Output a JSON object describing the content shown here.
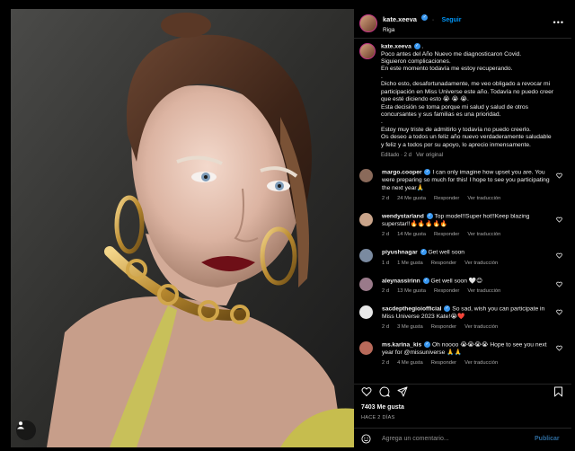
{
  "post": {
    "username": "kate.xeeva",
    "follow_label": "Seguir",
    "location": "Riga",
    "more_label": "•••"
  },
  "caption": {
    "username": "kate.xeeva",
    "lines": [
      "Poco antes del Año Nuevo me diagnosticaron Covid.",
      "Siguieron complicaciones.",
      "En este momento todavía me estoy recuperando.",
      ".",
      "Dicho esto, desafortunadamente, me veo obligado a revocar mi",
      "participación en Miss Universe este año. Todavía no puedo creer",
      "que esté diciendo esto 😭 😭 😭.",
      "Esta decisión se toma porque mi salud y salud de otros",
      "concursantes y sus familias es una prioridad.",
      ".",
      "Estoy muy triste de admitirlo y todavía no puedo creerlo.",
      "Os deseo a todos un feliz año nuevo verdaderamente saludable",
      "y feliz y a todos por su apoyo, lo aprecio inmensamente."
    ],
    "edited": "Editado · 2 d",
    "see_original": "Ver original"
  },
  "comments": [
    {
      "username": "margo.cooper",
      "text": "I can only imagine how upset you are. You were preparing so much for this! I hope to see you participating the next year🙏",
      "time": "2 d",
      "likes": "24 Me gusta",
      "reply": "Responder",
      "translate": "Ver traducción",
      "avatar_color": "#8a6a5a"
    },
    {
      "username": "wendystarland",
      "text": "Top model!!Super hot!!Keep blazing superstar!!🔥🔥🔥🔥🔥",
      "time": "2 d",
      "likes": "14 Me gusta",
      "reply": "Responder",
      "translate": "Ver traducción",
      "avatar_color": "#c9a48a"
    },
    {
      "username": "piyushnagar",
      "text": "Get well soon",
      "time": "1 d",
      "likes": "1 Me gusta",
      "reply": "Responder",
      "translate": "Ver traducción",
      "avatar_color": "#7a8aa0"
    },
    {
      "username": "aleynassirinn",
      "text": "Get well soon 🤍😊",
      "time": "2 d",
      "likes": "13 Me gusta",
      "reply": "Responder",
      "translate": "Ver traducción",
      "avatar_color": "#9a7a8a"
    },
    {
      "username": "sacdepthegioiofficial",
      "text": "So sad, wish you can participate in Miss Universe 2023 Kate!😭❤️",
      "time": "2 d",
      "likes": "3 Me gusta",
      "reply": "Responder",
      "translate": "Ver traducción",
      "avatar_color": "#e8e8e8"
    },
    {
      "username": "ms.karina_kis",
      "text": "Oh noooo 😭😭😭😭 Hope to see you next year for @missuniverse 🙏🙏",
      "time": "2 d",
      "likes": "4 Me gusta",
      "reply": "Responder",
      "translate": "Ver traducción",
      "avatar_color": "#b86a5a"
    }
  ],
  "footer": {
    "likes": "7403 Me gusta",
    "ago": "HACE 2 DÍAS",
    "add_placeholder": "Agrega un comentario...",
    "publish_label": "Publicar"
  },
  "colors": {
    "accent": "#0095f6",
    "verified": "#3897f0",
    "background": "#000000",
    "secondary_text": "#a8a8a8"
  },
  "icons": [
    "tag-user-icon",
    "heart-icon",
    "comment-icon",
    "share-icon",
    "bookmark-icon",
    "emoji-icon",
    "verified-badge-icon",
    "more-options-icon"
  ]
}
